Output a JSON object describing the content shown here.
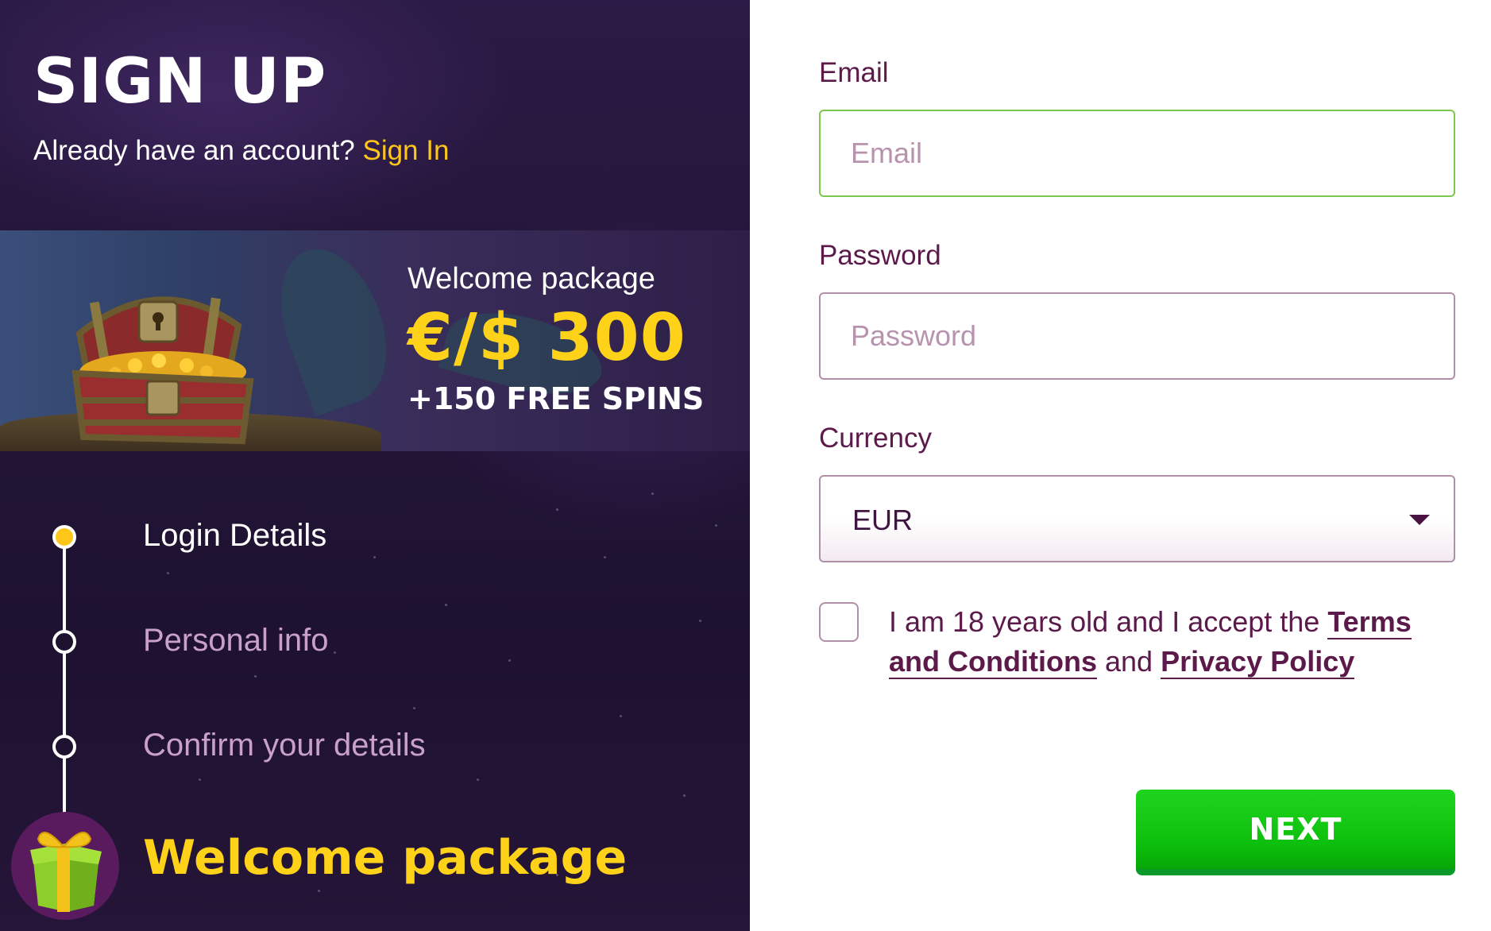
{
  "header": {
    "title": "SIGN UP",
    "already_text": "Already have an account?",
    "signin_link": "Sign In"
  },
  "banner": {
    "label": "Welcome package",
    "amount": "€/$ 300",
    "spins": "+150 FREE SPINS"
  },
  "steps": [
    {
      "label": "Login Details",
      "active": true
    },
    {
      "label": "Personal info",
      "active": false
    },
    {
      "label": "Confirm your details",
      "active": false
    }
  ],
  "final_step": {
    "label": "Welcome package",
    "icon": "gift-icon"
  },
  "form": {
    "email_label": "Email",
    "email_placeholder": "Email",
    "password_label": "Password",
    "password_placeholder": "Password",
    "currency_label": "Currency",
    "currency_value": "EUR",
    "terms_prefix": "I am 18 years old and I accept the",
    "terms_link": "Terms and Conditions",
    "terms_and": "and",
    "privacy_link": "Privacy Policy",
    "next_label": "NEXT"
  },
  "colors": {
    "accent_yellow": "#ffc61a",
    "brand_text": "#5c1a4a",
    "next_green": "#0cbf0c",
    "focus_border": "#7bc84a"
  }
}
